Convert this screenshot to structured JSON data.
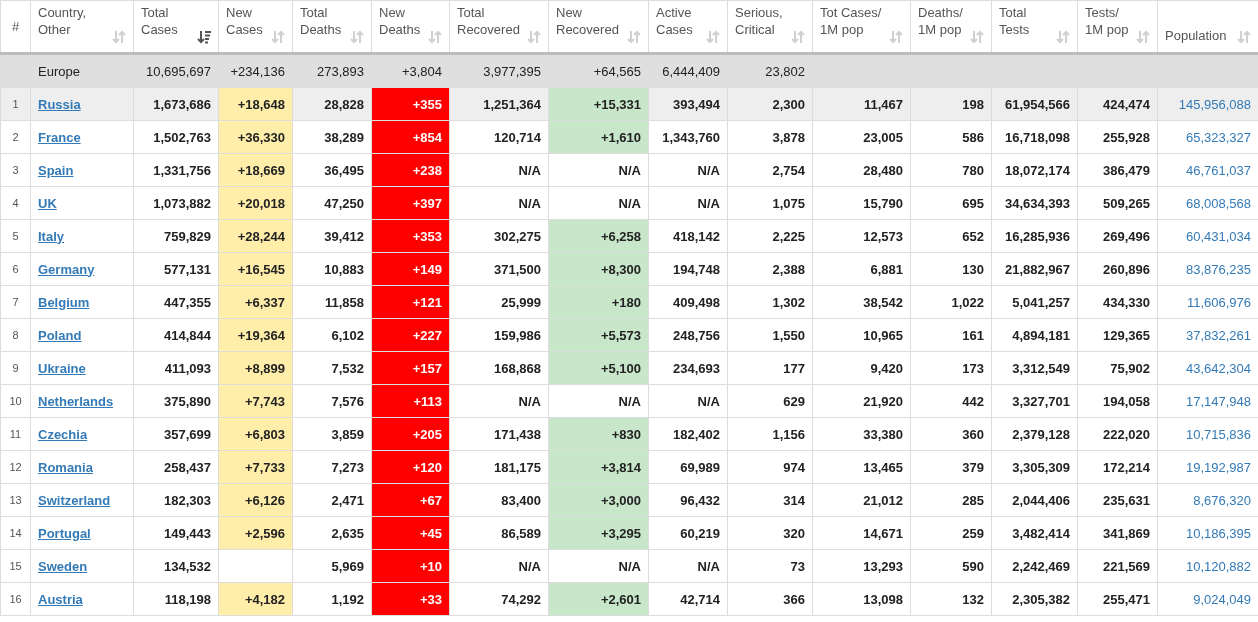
{
  "columns": [
    {
      "label": "#",
      "kind": "rank"
    },
    {
      "label": "Country,\nOther",
      "kind": "link",
      "sorted": false
    },
    {
      "label": "Total\nCases",
      "kind": "number",
      "sorted": true
    },
    {
      "label": "New\nCases",
      "kind": "number",
      "sorted": false,
      "color": "#ffeeaa"
    },
    {
      "label": "Total\nDeaths",
      "kind": "number",
      "sorted": false
    },
    {
      "label": "New\nDeaths",
      "kind": "number",
      "sorted": false,
      "color": "#ff0000"
    },
    {
      "label": "Total\nRecovered",
      "kind": "number",
      "sorted": false
    },
    {
      "label": "New\nRecovered",
      "kind": "number",
      "sorted": false,
      "color": "#c8e6c9"
    },
    {
      "label": "Active\nCases",
      "kind": "number",
      "sorted": false
    },
    {
      "label": "Serious,\nCritical",
      "kind": "number",
      "sorted": false
    },
    {
      "label": "Tot Cases/\n1M pop",
      "kind": "number",
      "sorted": false
    },
    {
      "label": "Deaths/\n1M pop",
      "kind": "number",
      "sorted": false
    },
    {
      "label": "Total\nTests",
      "kind": "number",
      "sorted": false
    },
    {
      "label": "Tests/\n1M pop",
      "kind": "number",
      "sorted": false
    },
    {
      "label": "Population",
      "kind": "plainlink",
      "sorted": false
    }
  ],
  "total_row": [
    "Europe",
    "10,695,697",
    "+234,136",
    "273,893",
    "+3,804",
    "3,977,395",
    "+64,565",
    "6,444,409",
    "23,802"
  ],
  "rows": [
    {
      "rank": "1",
      "highlighted": true,
      "country": "Russia",
      "total_cases": "1,673,686",
      "new_cases": "+18,648",
      "total_deaths": "28,828",
      "new_deaths": "+355",
      "total_recovered": "1,251,364",
      "new_recovered": "+15,331",
      "active_cases": "393,494",
      "serious_critical": "2,300",
      "cases_per_1m": "11,467",
      "deaths_per_1m": "198",
      "total_tests": "61,954,566",
      "tests_per_1m": "424,474",
      "population": "145,956,088"
    },
    {
      "rank": "2",
      "highlighted": false,
      "country": "France",
      "total_cases": "1,502,763",
      "new_cases": "+36,330",
      "total_deaths": "38,289",
      "new_deaths": "+854",
      "total_recovered": "120,714",
      "new_recovered": "+1,610",
      "active_cases": "1,343,760",
      "serious_critical": "3,878",
      "cases_per_1m": "23,005",
      "deaths_per_1m": "586",
      "total_tests": "16,718,098",
      "tests_per_1m": "255,928",
      "population": "65,323,327"
    },
    {
      "rank": "3",
      "highlighted": false,
      "country": "Spain",
      "total_cases": "1,331,756",
      "new_cases": "+18,669",
      "total_deaths": "36,495",
      "new_deaths": "+238",
      "total_recovered": "N/A",
      "new_recovered": "N/A",
      "active_cases": "N/A",
      "serious_critical": "2,754",
      "cases_per_1m": "28,480",
      "deaths_per_1m": "780",
      "total_tests": "18,072,174",
      "tests_per_1m": "386,479",
      "population": "46,761,037"
    },
    {
      "rank": "4",
      "highlighted": false,
      "country": "UK",
      "total_cases": "1,073,882",
      "new_cases": "+20,018",
      "total_deaths": "47,250",
      "new_deaths": "+397",
      "total_recovered": "N/A",
      "new_recovered": "N/A",
      "active_cases": "N/A",
      "serious_critical": "1,075",
      "cases_per_1m": "15,790",
      "deaths_per_1m": "695",
      "total_tests": "34,634,393",
      "tests_per_1m": "509,265",
      "population": "68,008,568"
    },
    {
      "rank": "5",
      "highlighted": false,
      "country": "Italy",
      "total_cases": "759,829",
      "new_cases": "+28,244",
      "total_deaths": "39,412",
      "new_deaths": "+353",
      "total_recovered": "302,275",
      "new_recovered": "+6,258",
      "active_cases": "418,142",
      "serious_critical": "2,225",
      "cases_per_1m": "12,573",
      "deaths_per_1m": "652",
      "total_tests": "16,285,936",
      "tests_per_1m": "269,496",
      "population": "60,431,034"
    },
    {
      "rank": "6",
      "highlighted": false,
      "country": "Germany",
      "total_cases": "577,131",
      "new_cases": "+16,545",
      "total_deaths": "10,883",
      "new_deaths": "+149",
      "total_recovered": "371,500",
      "new_recovered": "+8,300",
      "active_cases": "194,748",
      "serious_critical": "2,388",
      "cases_per_1m": "6,881",
      "deaths_per_1m": "130",
      "total_tests": "21,882,967",
      "tests_per_1m": "260,896",
      "population": "83,876,235"
    },
    {
      "rank": "7",
      "highlighted": false,
      "country": "Belgium",
      "total_cases": "447,355",
      "new_cases": "+6,337",
      "total_deaths": "11,858",
      "new_deaths": "+121",
      "total_recovered": "25,999",
      "new_recovered": "+180",
      "active_cases": "409,498",
      "serious_critical": "1,302",
      "cases_per_1m": "38,542",
      "deaths_per_1m": "1,022",
      "total_tests": "5,041,257",
      "tests_per_1m": "434,330",
      "population": "11,606,976"
    },
    {
      "rank": "8",
      "highlighted": false,
      "country": "Poland",
      "total_cases": "414,844",
      "new_cases": "+19,364",
      "total_deaths": "6,102",
      "new_deaths": "+227",
      "total_recovered": "159,986",
      "new_recovered": "+5,573",
      "active_cases": "248,756",
      "serious_critical": "1,550",
      "cases_per_1m": "10,965",
      "deaths_per_1m": "161",
      "total_tests": "4,894,181",
      "tests_per_1m": "129,365",
      "population": "37,832,261"
    },
    {
      "rank": "9",
      "highlighted": false,
      "country": "Ukraine",
      "total_cases": "411,093",
      "new_cases": "+8,899",
      "total_deaths": "7,532",
      "new_deaths": "+157",
      "total_recovered": "168,868",
      "new_recovered": "+5,100",
      "active_cases": "234,693",
      "serious_critical": "177",
      "cases_per_1m": "9,420",
      "deaths_per_1m": "173",
      "total_tests": "3,312,549",
      "tests_per_1m": "75,902",
      "population": "43,642,304"
    },
    {
      "rank": "10",
      "highlighted": false,
      "country": "Netherlands",
      "total_cases": "375,890",
      "new_cases": "+7,743",
      "total_deaths": "7,576",
      "new_deaths": "+113",
      "total_recovered": "N/A",
      "new_recovered": "N/A",
      "active_cases": "N/A",
      "serious_critical": "629",
      "cases_per_1m": "21,920",
      "deaths_per_1m": "442",
      "total_tests": "3,327,701",
      "tests_per_1m": "194,058",
      "population": "17,147,948"
    },
    {
      "rank": "11",
      "highlighted": false,
      "country": "Czechia",
      "total_cases": "357,699",
      "new_cases": "+6,803",
      "total_deaths": "3,859",
      "new_deaths": "+205",
      "total_recovered": "171,438",
      "new_recovered": "+830",
      "active_cases": "182,402",
      "serious_critical": "1,156",
      "cases_per_1m": "33,380",
      "deaths_per_1m": "360",
      "total_tests": "2,379,128",
      "tests_per_1m": "222,020",
      "population": "10,715,836"
    },
    {
      "rank": "12",
      "highlighted": false,
      "country": "Romania",
      "total_cases": "258,437",
      "new_cases": "+7,733",
      "total_deaths": "7,273",
      "new_deaths": "+120",
      "total_recovered": "181,175",
      "new_recovered": "+3,814",
      "active_cases": "69,989",
      "serious_critical": "974",
      "cases_per_1m": "13,465",
      "deaths_per_1m": "379",
      "total_tests": "3,305,309",
      "tests_per_1m": "172,214",
      "population": "19,192,987"
    },
    {
      "rank": "13",
      "highlighted": false,
      "country": "Switzerland",
      "total_cases": "182,303",
      "new_cases": "+6,126",
      "total_deaths": "2,471",
      "new_deaths": "+67",
      "total_recovered": "83,400",
      "new_recovered": "+3,000",
      "active_cases": "96,432",
      "serious_critical": "314",
      "cases_per_1m": "21,012",
      "deaths_per_1m": "285",
      "total_tests": "2,044,406",
      "tests_per_1m": "235,631",
      "population": "8,676,320"
    },
    {
      "rank": "14",
      "highlighted": false,
      "country": "Portugal",
      "total_cases": "149,443",
      "new_cases": "+2,596",
      "total_deaths": "2,635",
      "new_deaths": "+45",
      "total_recovered": "86,589",
      "new_recovered": "+3,295",
      "active_cases": "60,219",
      "serious_critical": "320",
      "cases_per_1m": "14,671",
      "deaths_per_1m": "259",
      "total_tests": "3,482,414",
      "tests_per_1m": "341,869",
      "population": "10,186,395"
    },
    {
      "rank": "15",
      "highlighted": false,
      "country": "Sweden",
      "total_cases": "134,532",
      "total_deaths": "5,969",
      "new_deaths": "+10",
      "total_recovered": "N/A",
      "new_recovered": "N/A",
      "active_cases": "N/A",
      "serious_critical": "73",
      "cases_per_1m": "13,293",
      "deaths_per_1m": "590",
      "total_tests": "2,242,469",
      "tests_per_1m": "221,569",
      "population": "10,120,882"
    },
    {
      "rank": "16",
      "highlighted": false,
      "country": "Austria",
      "total_cases": "118,198",
      "new_cases": "+4,182",
      "total_deaths": "1,192",
      "new_deaths": "+33",
      "total_recovered": "74,292",
      "new_recovered": "+2,601",
      "active_cases": "42,714",
      "serious_critical": "366",
      "cases_per_1m": "13,098",
      "deaths_per_1m": "132",
      "total_tests": "2,305,382",
      "tests_per_1m": "255,471",
      "population": "9,024,049"
    }
  ]
}
